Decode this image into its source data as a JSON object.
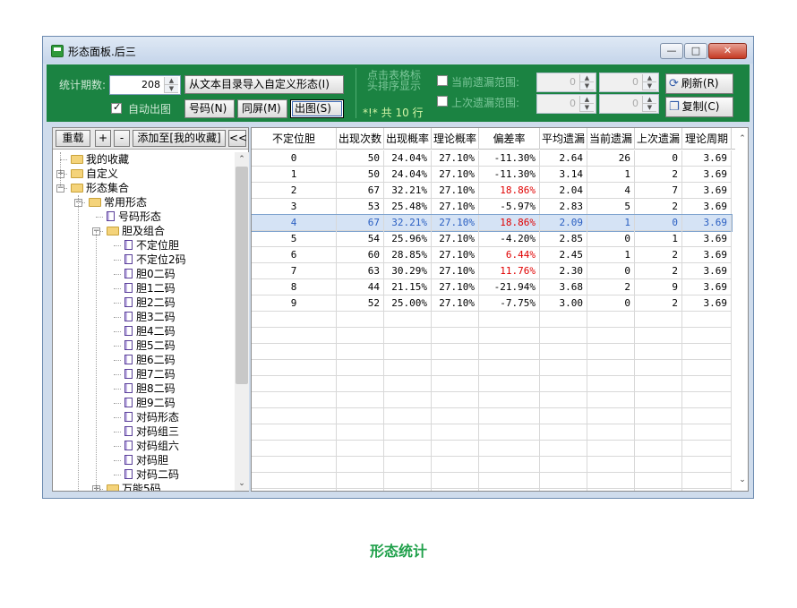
{
  "window": {
    "title": "形态面板.后三",
    "min_glyph": "—",
    "max_glyph": "□",
    "close_glyph": "✕"
  },
  "panel": {
    "periods_label": "统计期数:",
    "periods_value": "208",
    "import_button": "从文本目录导入自定义形态(I)",
    "auto_chart_label": "自动出图",
    "auto_chart_checked": true,
    "number_button": "号码(N)",
    "same_screen_button": "同屏(M)",
    "chart_button": "出图(S)",
    "hint_line1": "点击表格标",
    "hint_line2": "头排序显示",
    "total_text": "*!* 共 10 行",
    "current_miss_label": "当前遗漏范围:",
    "last_miss_label": "上次遗漏范围:",
    "current_from": "0",
    "current_to": "0",
    "last_from": "0",
    "last_to": "0",
    "refresh_button": "刷新(R)",
    "copy_button": "复制(C)"
  },
  "left_toolbar": {
    "reload": "重载",
    "plus": "+",
    "minus": "-",
    "add_fav": "添加至[我的收藏]",
    "collapse": "<<"
  },
  "tree": [
    {
      "label": "我的收藏",
      "level": 0,
      "type": "folder",
      "expander": ""
    },
    {
      "label": "自定义",
      "level": 0,
      "type": "folder",
      "expander": "+"
    },
    {
      "label": "形态集合",
      "level": 0,
      "type": "folder",
      "expander": "-"
    },
    {
      "label": "常用形态",
      "level": 1,
      "type": "folder",
      "expander": "-"
    },
    {
      "label": "号码形态",
      "level": 2,
      "type": "doc",
      "expander": ""
    },
    {
      "label": "胆及组合",
      "level": 2,
      "type": "folder",
      "expander": "-"
    },
    {
      "label": "不定位胆",
      "level": 3,
      "type": "doc",
      "expander": ""
    },
    {
      "label": "不定位2码",
      "level": 3,
      "type": "doc",
      "expander": ""
    },
    {
      "label": "胆0二码",
      "level": 3,
      "type": "doc",
      "expander": ""
    },
    {
      "label": "胆1二码",
      "level": 3,
      "type": "doc",
      "expander": ""
    },
    {
      "label": "胆2二码",
      "level": 3,
      "type": "doc",
      "expander": ""
    },
    {
      "label": "胆3二码",
      "level": 3,
      "type": "doc",
      "expander": ""
    },
    {
      "label": "胆4二码",
      "level": 3,
      "type": "doc",
      "expander": ""
    },
    {
      "label": "胆5二码",
      "level": 3,
      "type": "doc",
      "expander": ""
    },
    {
      "label": "胆6二码",
      "level": 3,
      "type": "doc",
      "expander": ""
    },
    {
      "label": "胆7二码",
      "level": 3,
      "type": "doc",
      "expander": ""
    },
    {
      "label": "胆8二码",
      "level": 3,
      "type": "doc",
      "expander": ""
    },
    {
      "label": "胆9二码",
      "level": 3,
      "type": "doc",
      "expander": ""
    },
    {
      "label": "对码形态",
      "level": 3,
      "type": "doc",
      "expander": ""
    },
    {
      "label": "对码组三",
      "level": 3,
      "type": "doc",
      "expander": ""
    },
    {
      "label": "对码组六",
      "level": 3,
      "type": "doc",
      "expander": ""
    },
    {
      "label": "对码胆",
      "level": 3,
      "type": "doc",
      "expander": ""
    },
    {
      "label": "对码二码",
      "level": 3,
      "type": "doc",
      "expander": ""
    },
    {
      "label": "万能5码",
      "level": 2,
      "type": "folder",
      "expander": "+"
    }
  ],
  "table": {
    "headers": [
      "不定位胆",
      "出现次数",
      "出现概率",
      "理论概率",
      "偏差率",
      "平均遗漏",
      "当前遗漏",
      "上次遗漏",
      "理论周期"
    ],
    "selected_row": 4,
    "rows": [
      [
        "0",
        "50",
        "24.04%",
        "27.10%",
        "-11.30%",
        "2.64",
        "26",
        "0",
        "3.69"
      ],
      [
        "1",
        "50",
        "24.04%",
        "27.10%",
        "-11.30%",
        "3.14",
        "1",
        "2",
        "3.69"
      ],
      [
        "2",
        "67",
        "32.21%",
        "27.10%",
        "18.86%",
        "2.04",
        "4",
        "7",
        "3.69"
      ],
      [
        "3",
        "53",
        "25.48%",
        "27.10%",
        "-5.97%",
        "2.83",
        "5",
        "2",
        "3.69"
      ],
      [
        "4",
        "67",
        "32.21%",
        "27.10%",
        "18.86%",
        "2.09",
        "1",
        "0",
        "3.69"
      ],
      [
        "5",
        "54",
        "25.96%",
        "27.10%",
        "-4.20%",
        "2.85",
        "0",
        "1",
        "3.69"
      ],
      [
        "6",
        "60",
        "28.85%",
        "27.10%",
        "6.44%",
        "2.45",
        "1",
        "2",
        "3.69"
      ],
      [
        "7",
        "63",
        "30.29%",
        "27.10%",
        "11.76%",
        "2.30",
        "0",
        "2",
        "3.69"
      ],
      [
        "8",
        "44",
        "21.15%",
        "27.10%",
        "-21.94%",
        "3.68",
        "2",
        "9",
        "3.69"
      ],
      [
        "9",
        "52",
        "25.00%",
        "27.10%",
        "-7.75%",
        "3.00",
        "0",
        "2",
        "3.69"
      ]
    ],
    "empty_rows": 12
  },
  "caption": "形态统计",
  "colors": {
    "panel_green": "#1b8342",
    "positive_deviation": "#e00000",
    "caption_green": "#1fa04a"
  }
}
